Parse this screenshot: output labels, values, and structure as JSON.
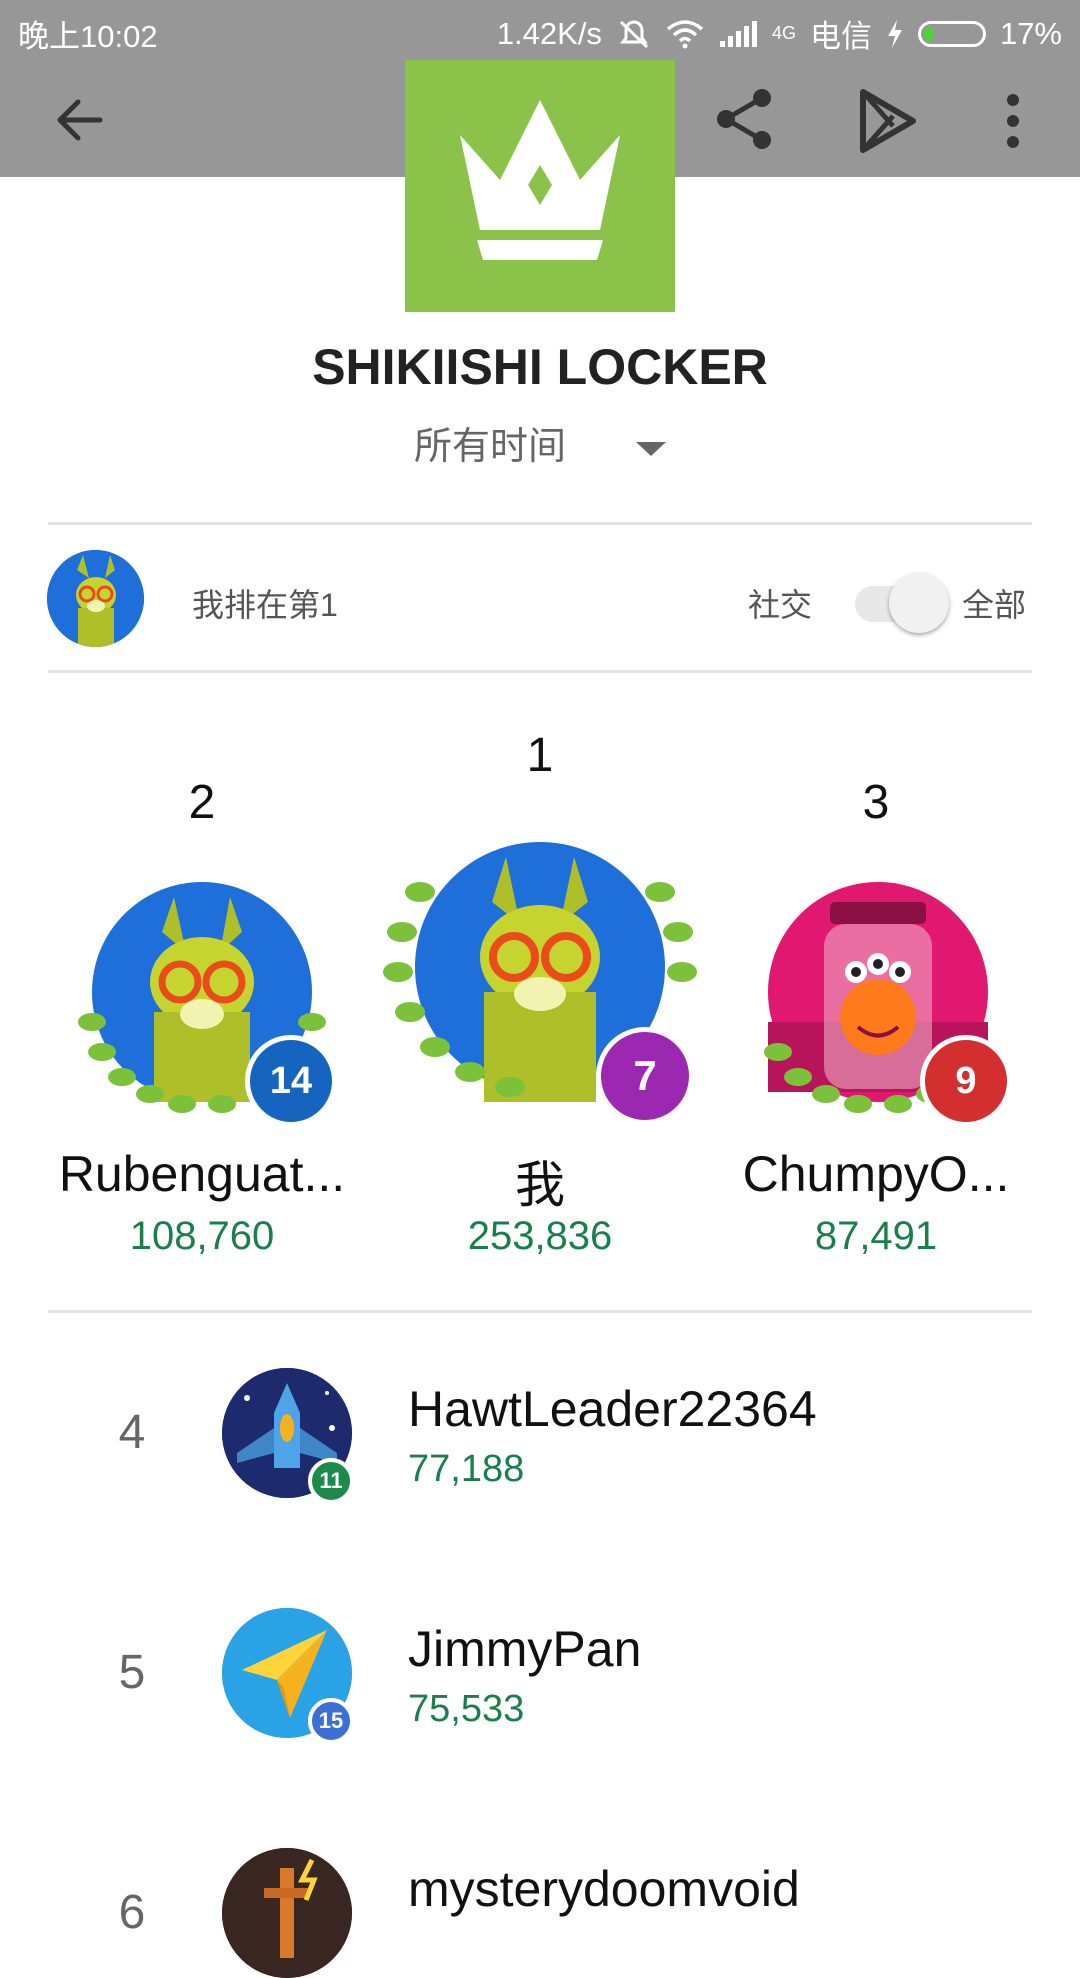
{
  "status_bar": {
    "time": "晚上10:02",
    "network_speed": "1.42K/s",
    "network_type": "4G",
    "carrier": "电信",
    "battery": "17%"
  },
  "app_bar": {
    "back_icon": "arrow-left-icon",
    "share_icon": "share-icon",
    "play_store_icon": "play-store-icon",
    "more_icon": "more-vert-icon"
  },
  "game": {
    "title": "SHIKIISHI LOCKER",
    "icon": "crown-icon",
    "icon_color": "#8bc34a"
  },
  "time_filter": {
    "selected": "所有时间"
  },
  "my_rank": {
    "text": "我排在第1",
    "social_label": "社交",
    "all_label": "全部"
  },
  "podium": [
    {
      "rank": "2",
      "name": "Rubenguat...",
      "score": "108,760",
      "level": "14",
      "badge_color": "#1565c0"
    },
    {
      "rank": "1",
      "name": "我",
      "score": "253,836",
      "level": "7",
      "badge_color": "#9c27b0"
    },
    {
      "rank": "3",
      "name": "ChumpyO...",
      "score": "87,491",
      "level": "9",
      "badge_color": "#d32f2f"
    }
  ],
  "list": [
    {
      "rank": "4",
      "name": "HawtLeader22364",
      "score": "77,188",
      "level": "11",
      "badge_color": "#1b8a4a"
    },
    {
      "rank": "5",
      "name": "JimmyPan",
      "score": "75,533",
      "level": "15",
      "badge_color": "#3b6fd6"
    },
    {
      "rank": "6",
      "name": "mysterydoomvoid",
      "score": "",
      "level": "",
      "badge_color": "#333333"
    }
  ],
  "colors": {
    "score_green": "#1a7f4b",
    "app_bar": "#979797"
  }
}
